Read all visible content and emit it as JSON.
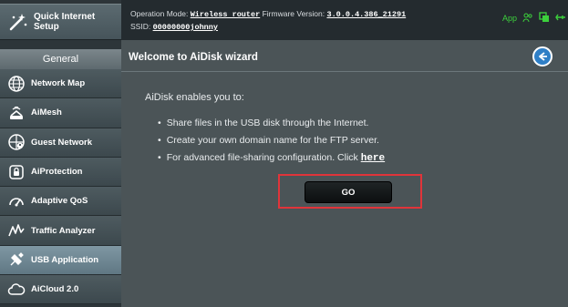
{
  "sidebar": {
    "quick_setup_label_line1": "Quick Internet",
    "quick_setup_label_line2": "Setup",
    "section_header": "General",
    "items": [
      {
        "label": "Network Map",
        "icon": "globe-network-icon"
      },
      {
        "label": "AiMesh",
        "icon": "mesh-router-icon"
      },
      {
        "label": "Guest Network",
        "icon": "guest-globe-icon"
      },
      {
        "label": "AiProtection",
        "icon": "lock-shield-icon"
      },
      {
        "label": "Adaptive QoS",
        "icon": "speedometer-icon"
      },
      {
        "label": "Traffic Analyzer",
        "icon": "traffic-wave-icon"
      },
      {
        "label": "USB Application",
        "icon": "usb-puzzle-icon",
        "active": true
      },
      {
        "label": "AiCloud 2.0",
        "icon": "cloud-icon"
      }
    ]
  },
  "topbar": {
    "op_mode_label": "Operation Mode:",
    "op_mode_value": "Wireless router",
    "fw_label": "Firmware Version:",
    "fw_value": "3.0.0.4.386_21291",
    "ssid_label": "SSID:",
    "ssid_value": "00000000johnny",
    "app_label": "App",
    "status_color": "#3cd13c"
  },
  "main": {
    "title": "Welcome to AiDisk wizard",
    "intro": "AiDisk enables you to:",
    "bullets": [
      "Share files in the USB disk through the Internet.",
      "Create your own domain name for the FTP server.",
      "For advanced file-sharing configuration. Click"
    ],
    "here_link": "here",
    "go_label": "GO",
    "highlight_color": "#e0343a"
  }
}
